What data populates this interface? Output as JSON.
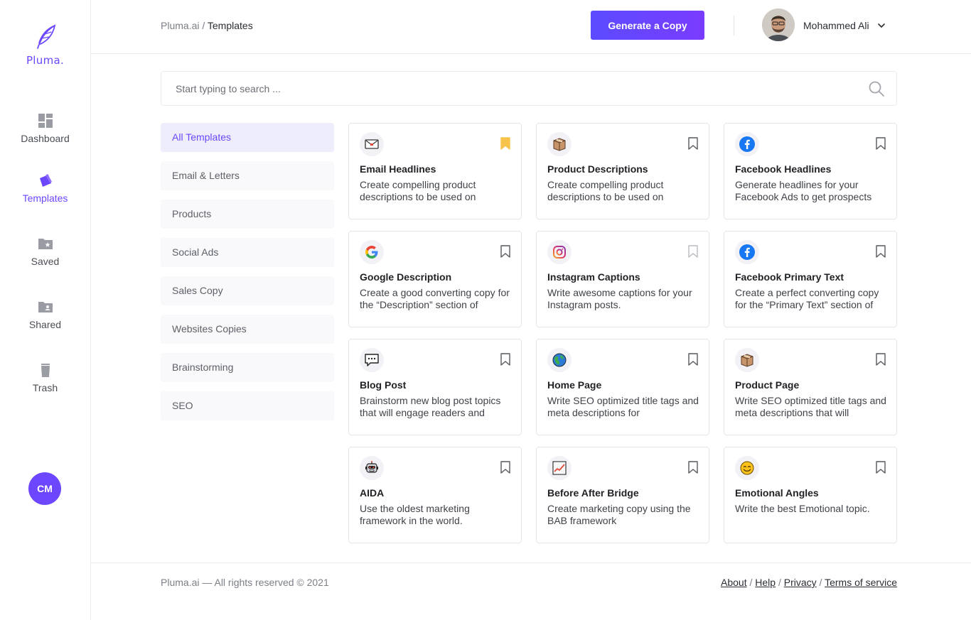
{
  "brand": {
    "name": "Pluma.",
    "accent": "#6c47ff"
  },
  "sidebar": {
    "items": [
      {
        "label": "Dashboard",
        "icon": "dashboard-icon",
        "active": false
      },
      {
        "label": "Templates",
        "icon": "templates-icon",
        "active": true
      },
      {
        "label": "Saved",
        "icon": "saved-folder-icon",
        "active": false
      },
      {
        "label": "Shared",
        "icon": "shared-folder-icon",
        "active": false
      },
      {
        "label": "Trash",
        "icon": "trash-icon",
        "active": false
      }
    ],
    "user_initials": "CM"
  },
  "header": {
    "breadcrumb_root": "Pluma.ai",
    "breadcrumb_sep": "/",
    "breadcrumb_current": "Templates",
    "generate_button": "Generate a Copy",
    "user_name": "Mohammed Ali"
  },
  "search": {
    "placeholder": "Start typing to search ..."
  },
  "categories": [
    "All Templates",
    "Email & Letters",
    "Products",
    "Social Ads",
    "Sales Copy",
    "Websites Copies",
    "Brainstorming",
    "SEO"
  ],
  "active_category": "All Templates",
  "templates": [
    {
      "title": "Email Headlines",
      "description": "Create compelling product descriptions to be used on",
      "icon": "email-icon",
      "bookmarked": true
    },
    {
      "title": "Product Descriptions",
      "description": "Create compelling product descriptions to be used on",
      "icon": "box-icon",
      "bookmarked": false
    },
    {
      "title": "Facebook Headlines",
      "description": "Generate headlines for your Facebook Ads to get prospects",
      "icon": "facebook-icon",
      "bookmarked": false
    },
    {
      "title": "Google Description",
      "description": "Create a good converting copy for the “Description” section of",
      "icon": "google-icon",
      "bookmarked": false
    },
    {
      "title": "Instagram Captions",
      "description": "Write awesome captions for your Instagram posts.",
      "icon": "instagram-icon",
      "bookmarked": false
    },
    {
      "title": "Facebook Primary Text",
      "description": "Create a perfect converting copy for the “Primary Text” section of",
      "icon": "facebook-icon",
      "bookmarked": false
    },
    {
      "title": "Blog Post",
      "description": "Brainstorm new blog post topics that will engage readers and",
      "icon": "chat-bubble-icon",
      "bookmarked": false
    },
    {
      "title": "Home Page",
      "description": "Write SEO optimized title tags and meta descriptions for",
      "icon": "globe-icon",
      "bookmarked": false
    },
    {
      "title": "Product Page",
      "description": "Write SEO optimized title tags and meta descriptions that will",
      "icon": "box-icon",
      "bookmarked": false
    },
    {
      "title": "AIDA",
      "description": "Use the oldest marketing framework in the world.",
      "icon": "robot-icon",
      "bookmarked": false
    },
    {
      "title": "Before After Bridge",
      "description": "Create marketing copy using the BAB framework",
      "icon": "chart-increasing-icon",
      "bookmarked": false
    },
    {
      "title": "Emotional Angles",
      "description": "Write the best Emotional topic.",
      "icon": "smiling-face-icon",
      "bookmarked": false
    }
  ],
  "footer": {
    "copyright": "Pluma.ai — All rights reserved © 2021",
    "links": [
      "About",
      "Help",
      "Privacy",
      "Terms of service"
    ],
    "link_sep": "/"
  }
}
